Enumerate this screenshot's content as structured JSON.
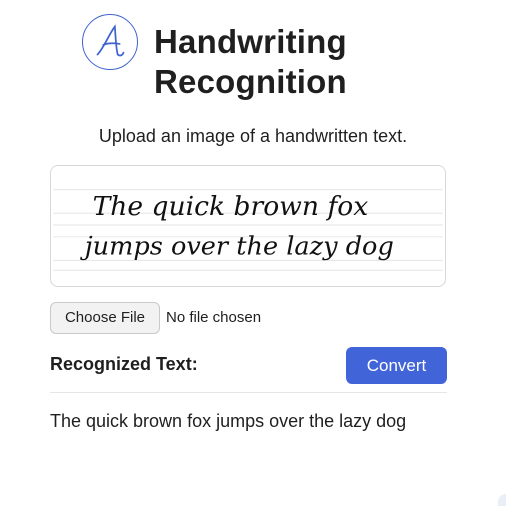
{
  "header": {
    "logo_icon": "cursive-a-logo-icon",
    "title_line1": "Handwriting",
    "title_line2": "Recognition"
  },
  "upload": {
    "instruction": "Upload an image of a handwritten text.",
    "preview_line1": "The quick brown fox",
    "preview_line2": "jumps over the lazy dog",
    "choose_file_label": "Choose File",
    "file_status": "No file chosen"
  },
  "result": {
    "label": "Recognized Text:",
    "convert_label": "Convert",
    "text": "The quick brown fox jumps over the lazy dog"
  },
  "colors": {
    "accent": "#4164d8",
    "logo": "#3f63cf",
    "text": "#1f1f1f"
  }
}
